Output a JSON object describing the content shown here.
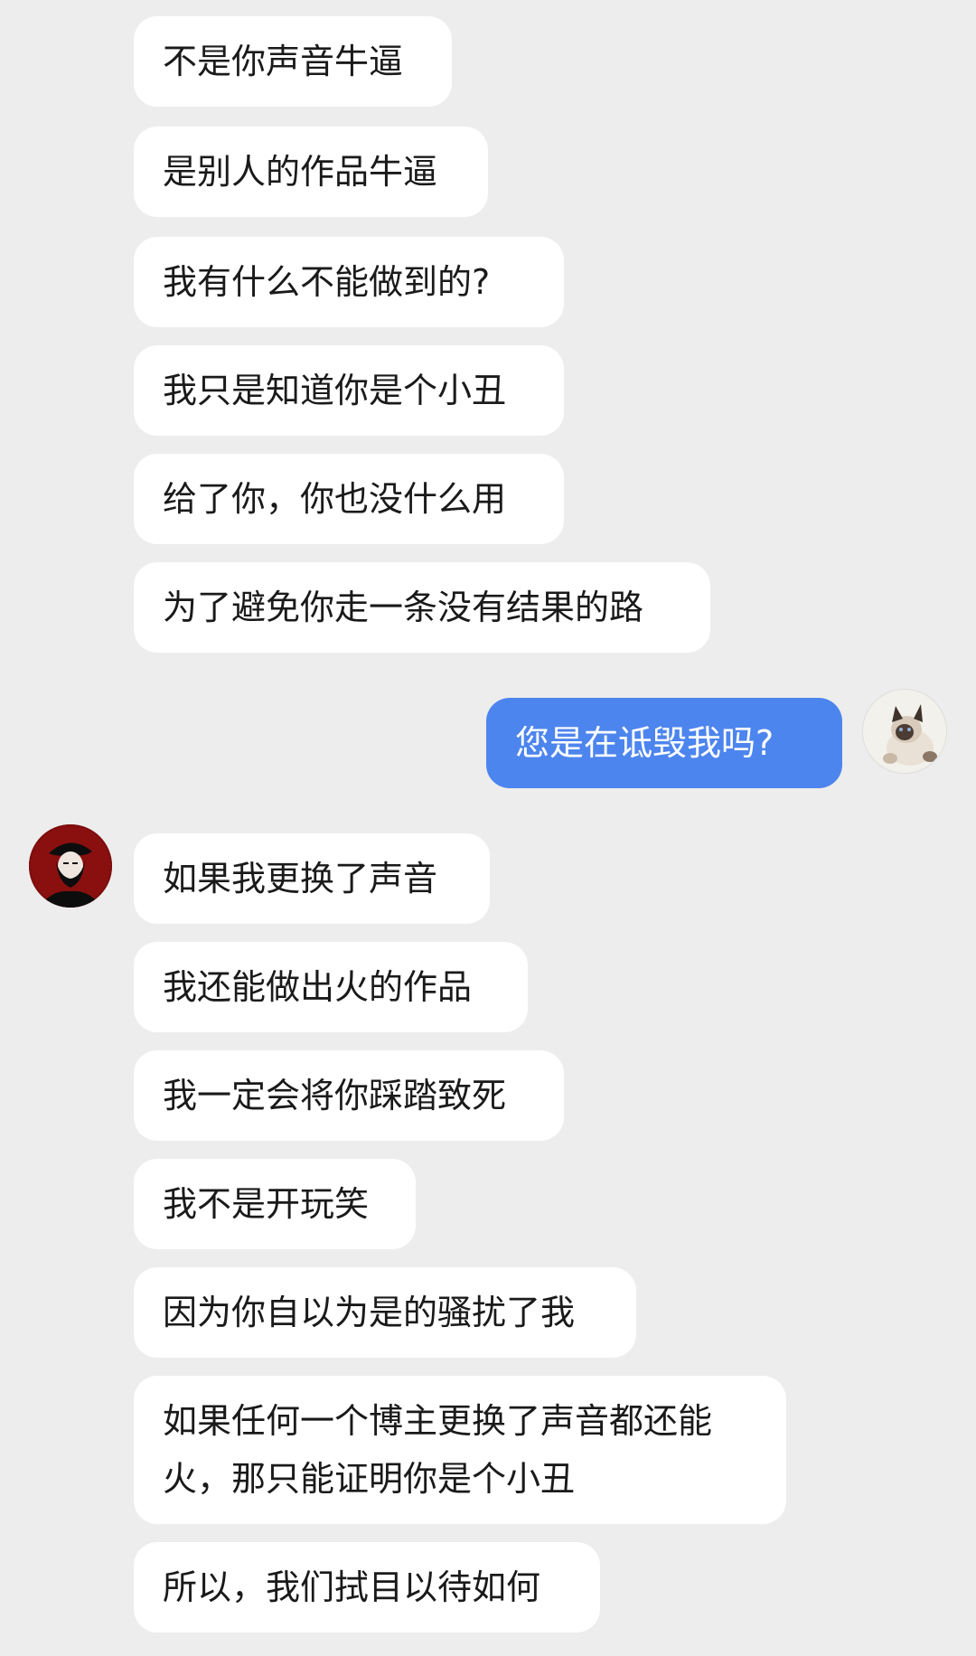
{
  "colors": {
    "background": "#ededed",
    "incoming_bubble": "#ffffff",
    "outgoing_bubble": "#4d85ee"
  },
  "messages_top": [
    "不是你声音牛逼",
    "是别人的作品牛逼",
    "我有什么不能做到的?",
    "我只是知道你是个小丑",
    "给了你，你也没什么用",
    "为了避免你走一条没有结果的路"
  ],
  "self_message": "您是在诋毁我吗?",
  "messages_bottom": [
    "如果我更换了声音",
    "我还能做出火的作品",
    "我一定会将你踩踏致死",
    "我不是开玩笑",
    "因为你自以为是的骚扰了我",
    "如果任何一个博主更换了声音都还能\n火，那只能证明你是个小丑",
    "所以，我们拭目以待如何"
  ],
  "avatars": {
    "self": "cat-avatar",
    "other": "portrait-avatar"
  }
}
